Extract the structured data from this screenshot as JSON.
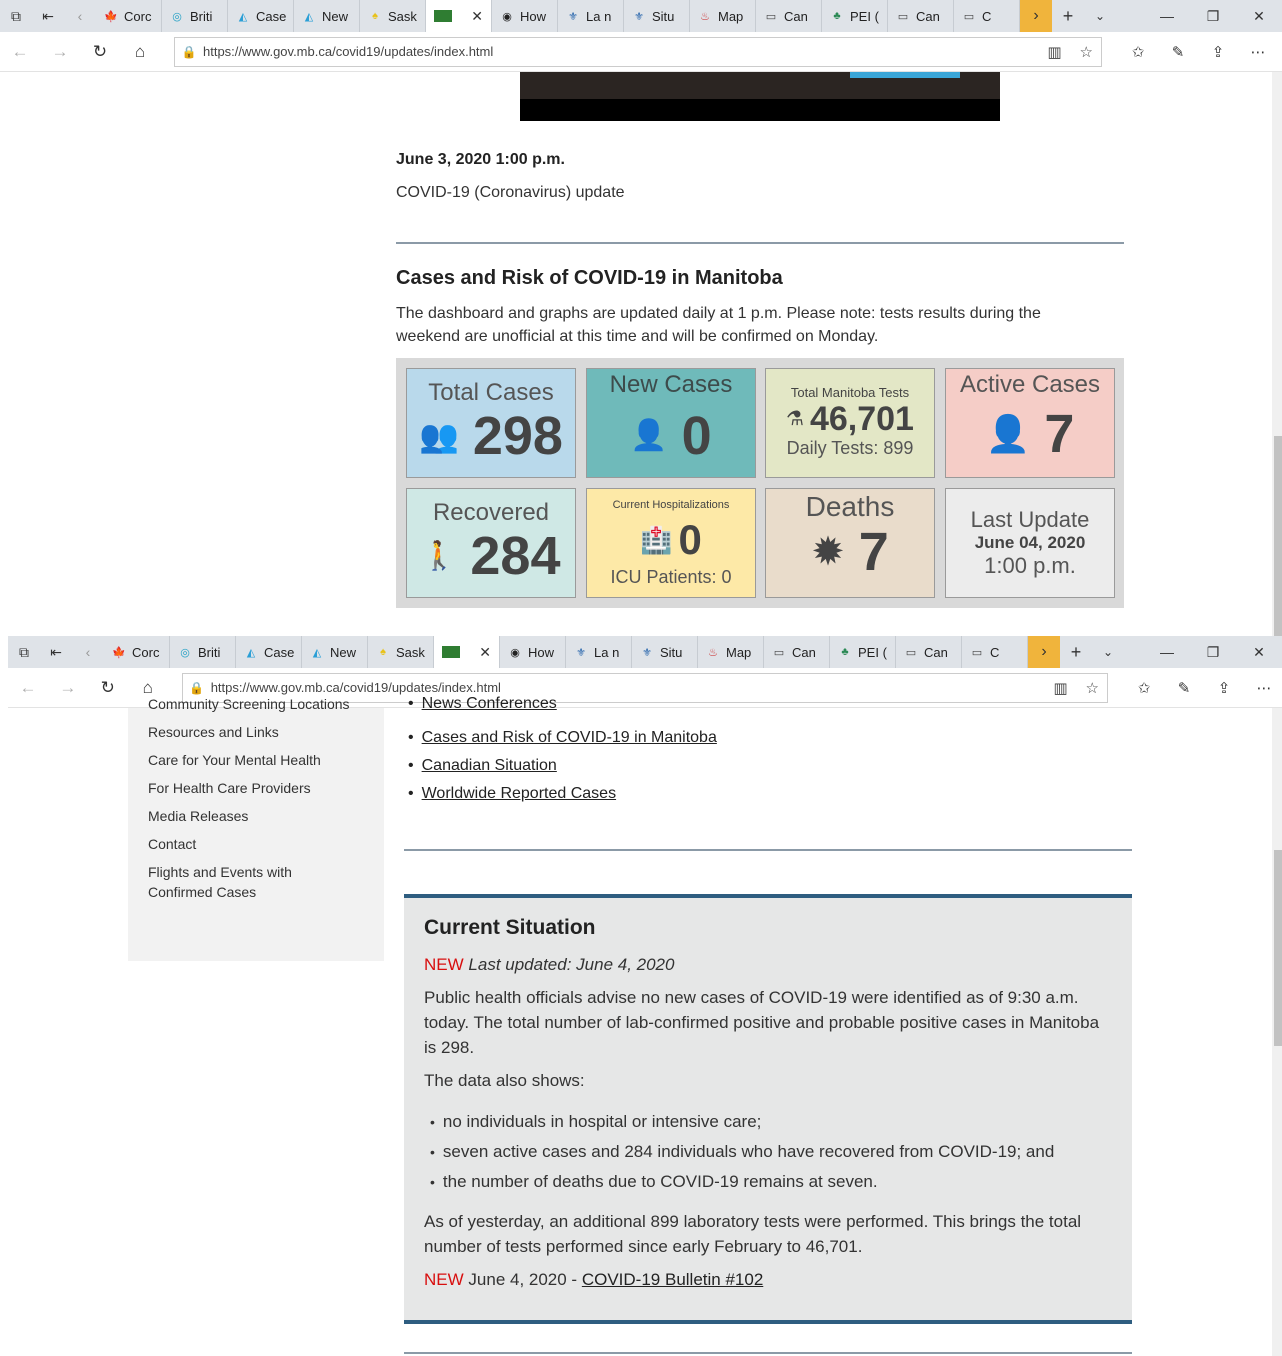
{
  "tabs": [
    {
      "label": "Corc",
      "icon": "maple-leaf-icon",
      "color": "#c8102e"
    },
    {
      "label": "Briti",
      "icon": "bc-icon",
      "color": "#1f9fc4"
    },
    {
      "label": "Case",
      "icon": "canada-chart-icon",
      "color": "#2a9fd6"
    },
    {
      "label": "New",
      "icon": "canada-chart-icon",
      "color": "#2a9fd6"
    },
    {
      "label": "Sask",
      "icon": "sask-icon",
      "color": "#e8c21a"
    },
    {
      "label": "",
      "icon": "manitoba-icon",
      "color": "#2f7d32"
    },
    {
      "label": "How",
      "icon": "shield-icon",
      "color": "#222222"
    },
    {
      "label": "La n",
      "icon": "quebec-icon",
      "color": "#1f5fa9"
    },
    {
      "label": "Situ",
      "icon": "quebec-icon",
      "color": "#1f5fa9"
    },
    {
      "label": "Map",
      "icon": "map-icon",
      "color": "#c33"
    },
    {
      "label": "Can",
      "icon": "page-icon",
      "color": "#444"
    },
    {
      "label": "PEI (",
      "icon": "pei-icon",
      "color": "#2c8a56"
    },
    {
      "label": "Can",
      "icon": "page-icon",
      "color": "#444"
    },
    {
      "label": "C",
      "icon": "page-icon",
      "color": "#444"
    }
  ],
  "url": {
    "host": "https://www.gov.mb.ca",
    "path": "/covid19/updates/index.html"
  },
  "page1": {
    "date": "June 3, 2020 1:00 p.m.",
    "update": "COVID-19 (Coronavirus) update",
    "heading": "Cases and Risk of COVID-19 in Manitoba",
    "intro": "The dashboard and graphs are updated daily at 1 p.m. Please note: tests results during the weekend are unofficial at this time and will be confirmed on Monday."
  },
  "dashboard": {
    "total_cases": {
      "label": "Total Cases",
      "value": "298"
    },
    "new_cases": {
      "label": "New Cases",
      "value": "0"
    },
    "tests": {
      "label": "Total Manitoba Tests",
      "value": "46,701",
      "sub": "Daily Tests: 899"
    },
    "active": {
      "label": "Active Cases",
      "value": "7"
    },
    "recovered": {
      "label": "Recovered",
      "value": "284"
    },
    "hospital": {
      "label": "Current Hospitalizations",
      "value": "0",
      "sub": "ICU Patients: 0"
    },
    "deaths": {
      "label": "Deaths",
      "value": "7"
    },
    "last_update": {
      "label": "Last Update",
      "date": "June 04, 2020",
      "time": "1:00 p.m."
    }
  },
  "sidebar": {
    "cut_item": "Community Screening Locations",
    "items": [
      "Resources and Links",
      "Care for Your Mental Health",
      "For Health Care Providers",
      "Media Releases",
      "Contact",
      "Flights and Events with Confirmed Cases"
    ]
  },
  "toc": {
    "cut_item": "News Conferences",
    "items": [
      "Cases and Risk of COVID-19 in Manitoba",
      "Canadian Situation",
      "Worldwide Reported Cases"
    ]
  },
  "situation": {
    "heading": "Current Situation",
    "new_tag": "NEW",
    "last_updated": "Last updated: June 4, 2020",
    "p1": "Public health officials advise no new cases of COVID-19 were identified as of 9:30 a.m. today. The total number of lab-confirmed positive and probable positive cases in Manitoba is 298.",
    "p2": "The data also shows:",
    "bullets": [
      "no individuals in hospital or intensive care;",
      "seven active cases and 284 individuals who have recovered from COVID-19; and",
      "the number of deaths due to COVID-19 remains at seven."
    ],
    "p3": "As of yesterday, an additional 899 laboratory tests were performed. This brings the total number of tests performed since early February to 46,701.",
    "bulletin_date": "June 4, 2020 -",
    "bulletin_link": "COVID-19 Bulletin #102"
  }
}
